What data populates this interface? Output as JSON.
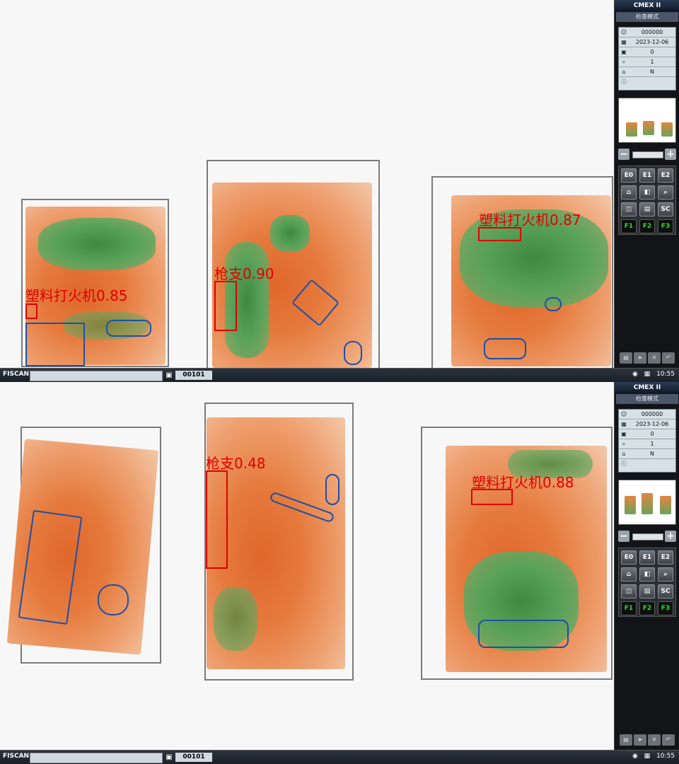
{
  "screens": [
    {
      "detections": [
        {
          "label": "塑料打火机0.85"
        },
        {
          "label": "枪支0.90"
        },
        {
          "label": "塑料打火机0.87"
        }
      ]
    },
    {
      "detections": [
        {
          "label": "枪支0.48"
        },
        {
          "label": "塑料打火机0.88"
        }
      ]
    }
  ],
  "panel": {
    "title": "CMEX II",
    "mode": "检查模式",
    "info": [
      {
        "icon": "operator-icon",
        "glyph": "☺",
        "value": "000000"
      },
      {
        "icon": "calendar-icon",
        "glyph": "▦",
        "value": "2023-12-06"
      },
      {
        "icon": "bag-count-icon",
        "glyph": "▣",
        "value": "0"
      },
      {
        "icon": "magnifier-icon",
        "glyph": "⌕",
        "value": "1"
      },
      {
        "icon": "network-icon",
        "glyph": "⌂",
        "value": "N"
      },
      {
        "icon": "info-icon",
        "glyph": "ⓘ",
        "value": ""
      }
    ],
    "buttons": [
      "E0",
      "E1",
      "E2",
      "⌂",
      "◧",
      "⌕",
      "◫",
      "▤",
      "SC",
      "F1",
      "F2",
      "F3"
    ]
  },
  "taskbar": {
    "brand": "FISCAN",
    "counter": "00101",
    "clock": "10:55"
  },
  "colors": {
    "detection": "#e00000",
    "panel_bg": "#121418",
    "fkey_text": "#25e025"
  }
}
